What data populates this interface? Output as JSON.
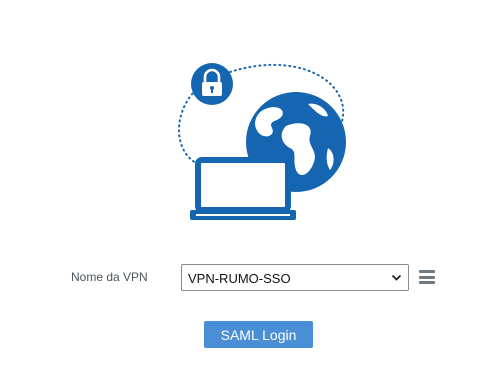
{
  "illustration": {
    "icons": [
      "lock-icon",
      "globe-icon",
      "laptop-icon"
    ],
    "accent_color": "#1565b0"
  },
  "vpn": {
    "label": "Nome da VPN",
    "selected": "VPN-RUMO-SSO"
  },
  "menu": {
    "icon": "hamburger-menu-icon",
    "color": "#6e7a83"
  },
  "login": {
    "button_label": "SAML Login",
    "color": "#4a8fd6"
  }
}
